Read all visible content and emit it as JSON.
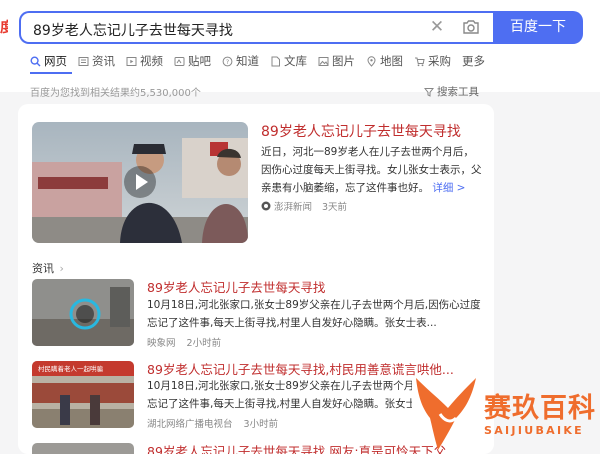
{
  "logo_fragment": "度",
  "search": {
    "query": "89岁老人忘记儿子去世每天寻找",
    "button": "百度一下",
    "clear_icon": "close-icon",
    "camera_icon": "camera-icon"
  },
  "tabs": [
    {
      "label": "网页",
      "icon": "search-icon"
    },
    {
      "label": "资讯",
      "icon": "news-icon"
    },
    {
      "label": "视频",
      "icon": "video-icon"
    },
    {
      "label": "贴吧",
      "icon": "tieba-icon"
    },
    {
      "label": "知道",
      "icon": "question-icon"
    },
    {
      "label": "文库",
      "icon": "doc-icon"
    },
    {
      "label": "图片",
      "icon": "image-icon"
    },
    {
      "label": "地图",
      "icon": "map-icon"
    },
    {
      "label": "采购",
      "icon": "cart-icon"
    },
    {
      "label": "更多"
    }
  ],
  "result_count": "百度为您找到相关结果约5,530,000个",
  "search_tools": "搜索工具",
  "main_result": {
    "title": "89岁老人忘记儿子去世每天寻找",
    "snippet_1": "近日，河北一89岁老人在儿子去世两个月后，",
    "snippet_2": "因伤心过度每天上街寻找。女儿张女士表示，父",
    "snippet_3": "亲患有小脑萎缩，忘了这件事也好。",
    "more": "详细 >",
    "source": "澎湃新闻",
    "time": "3天前"
  },
  "section_label": "资讯",
  "news": [
    {
      "title": "89岁老人忘记儿子去世每天寻找",
      "line1": "10月18日,河北张家口,张女士89岁父亲在儿子去世两个月后,因伤心过度",
      "line2": "忘记了这件事,每天上街寻找,村里人自发好心隐瞒。张女士表...",
      "source": "映象网",
      "time": "2小时前"
    },
    {
      "title": "89岁老人忘记儿子去世每天寻找,村民用善意谎言哄他...",
      "line1": "10月18日,河北张家口,张女士89岁父亲在儿子去世两个月后",
      "line2": "忘记了这件事,每天上街寻找,村里人自发好心隐瞒。张女士表",
      "source": "湖北网络广播电视台",
      "time": "3小时前"
    },
    {
      "title": "89岁老人忘记儿子去世每天寻找 网友:真是可怜天下父..."
    }
  ],
  "thumb_caption": "村民瞒着老人一起哄骗",
  "watermark": {
    "cn": "赛玖百科",
    "en": "SAIJIUBAIKE"
  },
  "colors": {
    "accent": "#4e6ef2",
    "title_red": "#c02d2d",
    "watermark_orange": "#ef6d2d"
  }
}
